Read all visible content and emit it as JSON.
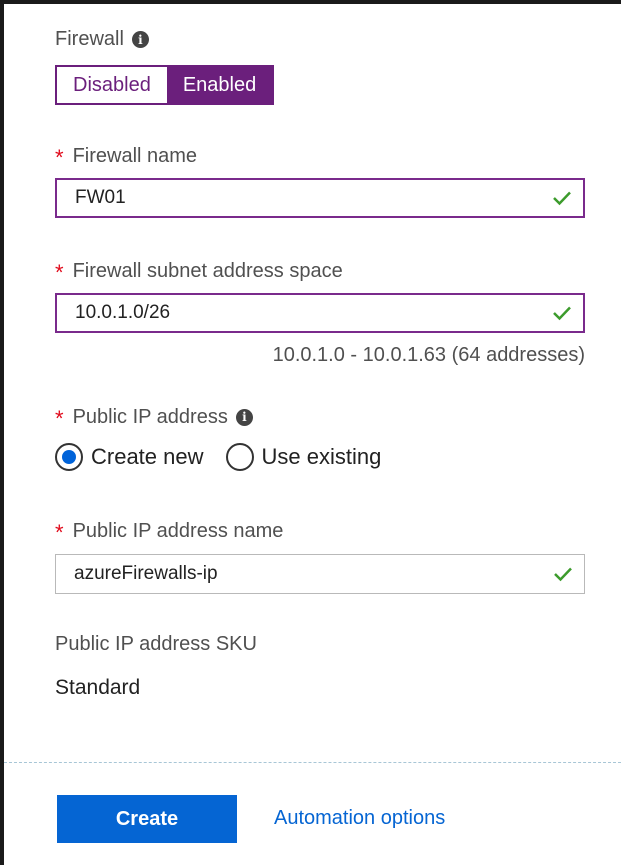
{
  "firewall": {
    "label": "Firewall",
    "options": [
      "Disabled",
      "Enabled"
    ],
    "selected": "Enabled"
  },
  "firewall_name": {
    "label": "Firewall name",
    "value": "FW01"
  },
  "subnet": {
    "label": "Firewall subnet address space",
    "value": "10.0.1.0/26",
    "hint": "10.0.1.0 - 10.0.1.63 (64 addresses)"
  },
  "public_ip": {
    "label": "Public IP address",
    "options": [
      "Create new",
      "Use existing"
    ],
    "selected": "Create new"
  },
  "public_ip_name": {
    "label": "Public IP address name",
    "value": "azureFirewalls-ip"
  },
  "sku": {
    "label": "Public IP address SKU",
    "value": "Standard"
  },
  "footer": {
    "create_label": "Create",
    "automation_label": "Automation options"
  },
  "colors": {
    "accent_purple": "#6b1f7c",
    "primary_blue": "#0565d3",
    "required_red": "#e00b1c",
    "valid_green": "#3c9b2c"
  }
}
